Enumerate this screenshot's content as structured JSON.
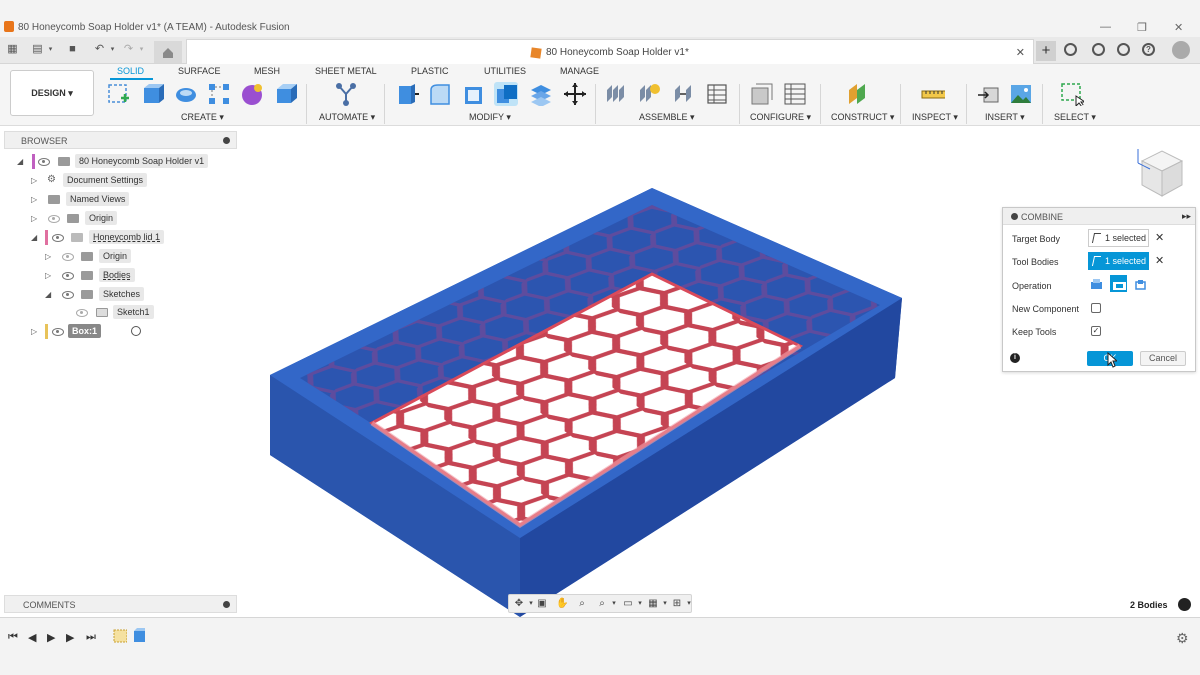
{
  "window": {
    "title": "80 Honeycomb Soap Holder v1* (A TEAM) - Autodesk Fusion",
    "document_tab": "80 Honeycomb Soap Holder v1*"
  },
  "ribbon": {
    "workspace": "DESIGN ▾",
    "tabs": [
      "SOLID",
      "SURFACE",
      "MESH",
      "SHEET METAL",
      "PLASTIC",
      "UTILITIES",
      "MANAGE"
    ],
    "active_tab": "SOLID",
    "groups": [
      "CREATE ▾",
      "AUTOMATE ▾",
      "MODIFY ▾",
      "ASSEMBLE ▾",
      "CONFIGURE ▾",
      "CONSTRUCT ▾",
      "INSPECT ▾",
      "INSERT ▾",
      "SELECT ▾"
    ]
  },
  "browser": {
    "header": "BROWSER",
    "nodes": [
      "80 Honeycomb Soap Holder v1",
      "Document Settings",
      "Named Views",
      "Origin",
      "Honeycomb lid 1",
      "Origin",
      "Bodies",
      "Sketches",
      "Sketch1",
      "Box:1"
    ]
  },
  "combine": {
    "title": "COMBINE",
    "target_body_label": "Target Body",
    "target_body_value": "1 selected",
    "tool_bodies_label": "Tool Bodies",
    "tool_bodies_value": "1 selected",
    "operation_label": "Operation",
    "new_component_label": "New Component",
    "new_component_checked": false,
    "keep_tools_label": "Keep Tools",
    "keep_tools_checked": true,
    "ok": "OK",
    "cancel": "Cancel"
  },
  "comments": {
    "header": "COMMENTS"
  },
  "status": {
    "bodies": "2 Bodies"
  },
  "colors": {
    "accent": "#0696d7",
    "body_blue": "#2d5fbf",
    "tool_pink": "#f0a0a8",
    "timeline_item": "#e8c35a"
  }
}
